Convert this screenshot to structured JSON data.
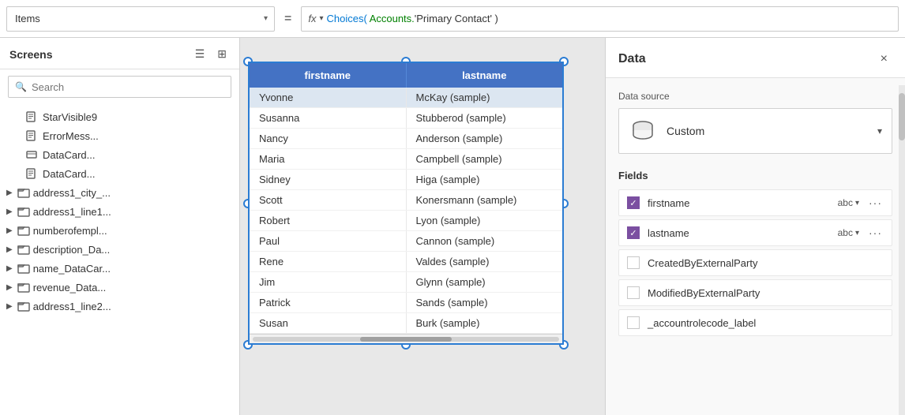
{
  "formulaBar": {
    "selectValue": "Items",
    "equalsSign": "=",
    "fxLabel": "fx",
    "formulaChoices": "Choices(",
    "formulaAccounts": " Accounts.",
    "formulaRest": "'Primary Contact' )"
  },
  "sidebar": {
    "title": "Screens",
    "searchPlaceholder": "Search",
    "items": [
      {
        "label": "StarVisible9",
        "icon": "edit-icon",
        "indent": 1
      },
      {
        "label": "ErrorMess...",
        "icon": "edit-icon",
        "indent": 1
      },
      {
        "label": "DataCard...",
        "icon": "card-icon",
        "indent": 1
      },
      {
        "label": "DataCard...",
        "icon": "edit-icon",
        "indent": 1
      },
      {
        "label": "address1_city_...",
        "icon": "folder-icon",
        "expandable": true,
        "indent": 0
      },
      {
        "label": "address1_line1...",
        "icon": "folder-icon",
        "expandable": true,
        "indent": 0
      },
      {
        "label": "numberofempl...",
        "icon": "folder-icon",
        "expandable": true,
        "indent": 0
      },
      {
        "label": "description_Da...",
        "icon": "folder-icon",
        "expandable": true,
        "indent": 0
      },
      {
        "label": "name_DataCar...",
        "icon": "folder-icon",
        "expandable": true,
        "indent": 0
      },
      {
        "label": "revenue_Data...",
        "icon": "folder-icon",
        "expandable": true,
        "indent": 0
      },
      {
        "label": "address1_line2...",
        "icon": "folder-icon",
        "expandable": true,
        "indent": 0
      }
    ]
  },
  "table": {
    "columns": [
      "firstname",
      "lastname"
    ],
    "rows": [
      {
        "firstname": "Yvonne",
        "lastname": "McKay (sample)"
      },
      {
        "firstname": "Susanna",
        "lastname": "Stubberod (sample)"
      },
      {
        "firstname": "Nancy",
        "lastname": "Anderson (sample)"
      },
      {
        "firstname": "Maria",
        "lastname": "Campbell (sample)"
      },
      {
        "firstname": "Sidney",
        "lastname": "Higa (sample)"
      },
      {
        "firstname": "Scott",
        "lastname": "Konersmann (sample)"
      },
      {
        "firstname": "Robert",
        "lastname": "Lyon (sample)"
      },
      {
        "firstname": "Paul",
        "lastname": "Cannon (sample)"
      },
      {
        "firstname": "Rene",
        "lastname": "Valdes (sample)"
      },
      {
        "firstname": "Jim",
        "lastname": "Glynn (sample)"
      },
      {
        "firstname": "Patrick",
        "lastname": "Sands (sample)"
      },
      {
        "firstname": "Susan",
        "lastname": "Burk (sample)"
      }
    ]
  },
  "rightPanel": {
    "title": "Data",
    "closeLabel": "×",
    "datasourceLabel": "Data source",
    "datasourceName": "Custom",
    "fieldsLabel": "Fields",
    "fields": [
      {
        "name": "firstname",
        "type": "abc",
        "checked": true
      },
      {
        "name": "lastname",
        "type": "abc",
        "checked": true
      },
      {
        "name": "CreatedByExternalParty",
        "type": "",
        "checked": false
      },
      {
        "name": "ModifiedByExternalParty",
        "type": "",
        "checked": false
      },
      {
        "name": "_accountrolecode_label",
        "type": "",
        "checked": false
      }
    ]
  }
}
